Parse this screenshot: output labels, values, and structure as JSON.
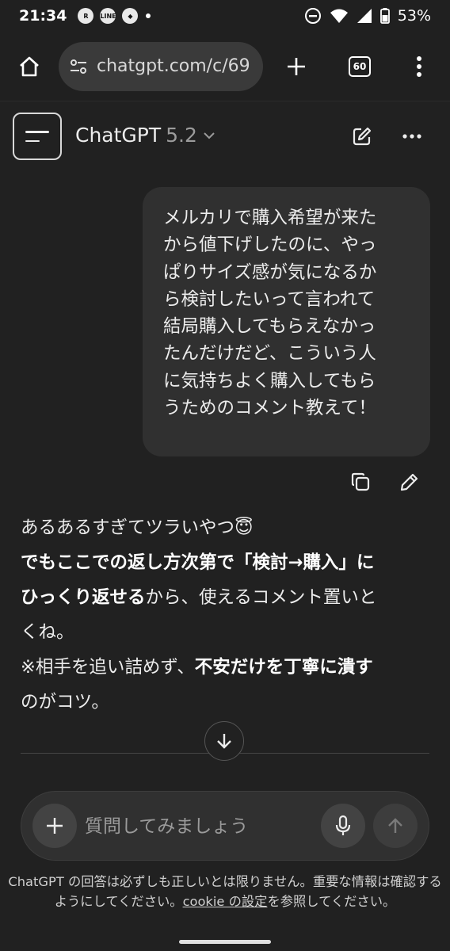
{
  "status_bar": {
    "time": "21:34",
    "battery": "53%",
    "notif_icons": [
      "rakuten-link-icon",
      "line-icon",
      "app-icon"
    ]
  },
  "browser": {
    "url": "chatgpt.com/c/69",
    "tab_count": "60"
  },
  "app_header": {
    "model_name": "ChatGPT",
    "model_version": "5.2"
  },
  "conversation": {
    "user_message_lines": [
      "メルカリで購入希望が来た",
      "から値下げしたのに、やっ",
      "ぱりサイズ感が気になるか",
      "ら検討したいって言われて",
      "結局購入してもらえなかっ",
      "たんだけだど、こういう人",
      "に気持ちよく購入してもら",
      "うためのコメント教えて！"
    ],
    "assistant": {
      "line1": "あるあるすぎてツラいやつ😇",
      "line2_bold": "でもここでの返し方次第で「検討→購入」に",
      "line3_bold": "ひっくり返せる",
      "line3_rest": "から、使えるコメント置いと",
      "line4": "くね。",
      "line5_pre": "※相手を追い詰めず、",
      "line5_bold": "不安だけを丁寧に潰す",
      "line6": "のがコツ。"
    }
  },
  "composer": {
    "placeholder": "質問してみましょう"
  },
  "disclaimer": {
    "text_before": "ChatGPT の回答は必ずしも正しいとは限りません。重要な情報は確認するようにしてください。",
    "link": "cookie の設定",
    "text_after": "を参照してください。"
  },
  "colors": {
    "background": "#212121",
    "bubble": "#303030",
    "text": "#ececec"
  }
}
